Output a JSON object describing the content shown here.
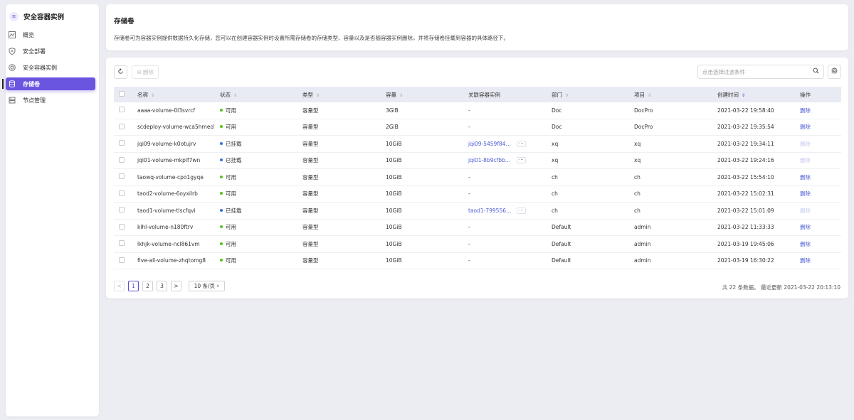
{
  "sidebar": {
    "title": "安全容器实例",
    "logo_icon": "≡",
    "items": [
      {
        "label": "概览",
        "icon": "chart-icon",
        "active": false
      },
      {
        "label": "安全部署",
        "icon": "shield-icon",
        "active": false
      },
      {
        "label": "安全容器实例",
        "icon": "container-icon",
        "active": false
      },
      {
        "label": "存储卷",
        "icon": "database-icon",
        "active": true
      },
      {
        "label": "节点管理",
        "icon": "server-icon",
        "active": false
      }
    ]
  },
  "header": {
    "title": "存储卷",
    "description": "存储卷可为容器实例提供数据持久化存储，您可以在创建容器实例时设置所需存储卷的存储类型、容量以及是否随容器实例删除，并将存储卷挂载到容器的具体路径下。"
  },
  "toolbar": {
    "delete_label": "删除",
    "search_placeholder": "点击选择过滤条件"
  },
  "table": {
    "columns": [
      "名称",
      "状态",
      "类型",
      "容量",
      "关联容器实例",
      "部门",
      "项目",
      "创建时间",
      "操作"
    ],
    "rows": [
      {
        "name": "aaaa-volume-0l3svrcf",
        "status": "可用",
        "status_color": "#52c41a",
        "type": "容量型",
        "capacity": "3GiB",
        "instance": "-",
        "dept": "Doc",
        "project": "DocPro",
        "created": "2021-03-22 19:58:40",
        "action": "删除",
        "action_disabled": false
      },
      {
        "name": "scdeploy-volume-wca5hmed",
        "status": "可用",
        "status_color": "#52c41a",
        "type": "容量型",
        "capacity": "2GiB",
        "instance": "-",
        "dept": "Doc",
        "project": "DocPro",
        "created": "2021-03-22 19:35:54",
        "action": "删除",
        "action_disabled": false
      },
      {
        "name": "jqi09-volume-k0otujrv",
        "status": "已挂载",
        "status_color": "#3b6fe0",
        "type": "容量型",
        "capacity": "10GiB",
        "instance": "jqi09-5459f84db...",
        "instance_more": "···",
        "dept": "xq",
        "project": "xq",
        "created": "2021-03-22 19:34:11",
        "action": "删除",
        "action_disabled": true
      },
      {
        "name": "jqi01-volume-mkplf7wn",
        "status": "已挂载",
        "status_color": "#3b6fe0",
        "type": "容量型",
        "capacity": "10GiB",
        "instance": "jqi01-8b9cfbb66...",
        "instance_more": "···",
        "dept": "xq",
        "project": "xq",
        "created": "2021-03-22 19:24:16",
        "action": "删除",
        "action_disabled": true
      },
      {
        "name": "taowq-volume-cpo1gyqe",
        "status": "可用",
        "status_color": "#52c41a",
        "type": "容量型",
        "capacity": "10GiB",
        "instance": "-",
        "dept": "ch",
        "project": "ch",
        "created": "2021-03-22 15:54:10",
        "action": "删除",
        "action_disabled": false
      },
      {
        "name": "taod2-volume-6oyxilrb",
        "status": "可用",
        "status_color": "#52c41a",
        "type": "容量型",
        "capacity": "10GiB",
        "instance": "-",
        "dept": "ch",
        "project": "ch",
        "created": "2021-03-22 15:02:31",
        "action": "删除",
        "action_disabled": false
      },
      {
        "name": "taod1-volume-tlscfqvi",
        "status": "已挂载",
        "status_color": "#3b6fe0",
        "type": "容量型",
        "capacity": "10GiB",
        "instance": "taod1-79955668...",
        "instance_more": "···",
        "dept": "ch",
        "project": "ch",
        "created": "2021-03-22 15:01:09",
        "action": "删除",
        "action_disabled": true
      },
      {
        "name": "klhl-volume-n180ftrv",
        "status": "可用",
        "status_color": "#52c41a",
        "type": "容量型",
        "capacity": "10GiB",
        "instance": "-",
        "dept": "Default",
        "project": "admin",
        "created": "2021-03-22 11:33:33",
        "action": "删除",
        "action_disabled": false
      },
      {
        "name": "lkhjk-volume-ncl861vm",
        "status": "可用",
        "status_color": "#52c41a",
        "type": "容量型",
        "capacity": "10GiB",
        "instance": "-",
        "dept": "Default",
        "project": "admin",
        "created": "2021-03-19 19:45:06",
        "action": "删除",
        "action_disabled": false
      },
      {
        "name": "five-all-volume-zhqtomg8",
        "status": "可用",
        "status_color": "#52c41a",
        "type": "容量型",
        "capacity": "10GiB",
        "instance": "-",
        "dept": "Default",
        "project": "admin",
        "created": "2021-03-19 16:30:22",
        "action": "删除",
        "action_disabled": false
      }
    ]
  },
  "pagination": {
    "prev": "<",
    "next": ">",
    "pages": [
      "1",
      "2",
      "3"
    ],
    "current": "1",
    "page_size": "10 条/页",
    "total_text": "共 22 条数据。 最近更新  2021-03-22 20:13:10"
  }
}
